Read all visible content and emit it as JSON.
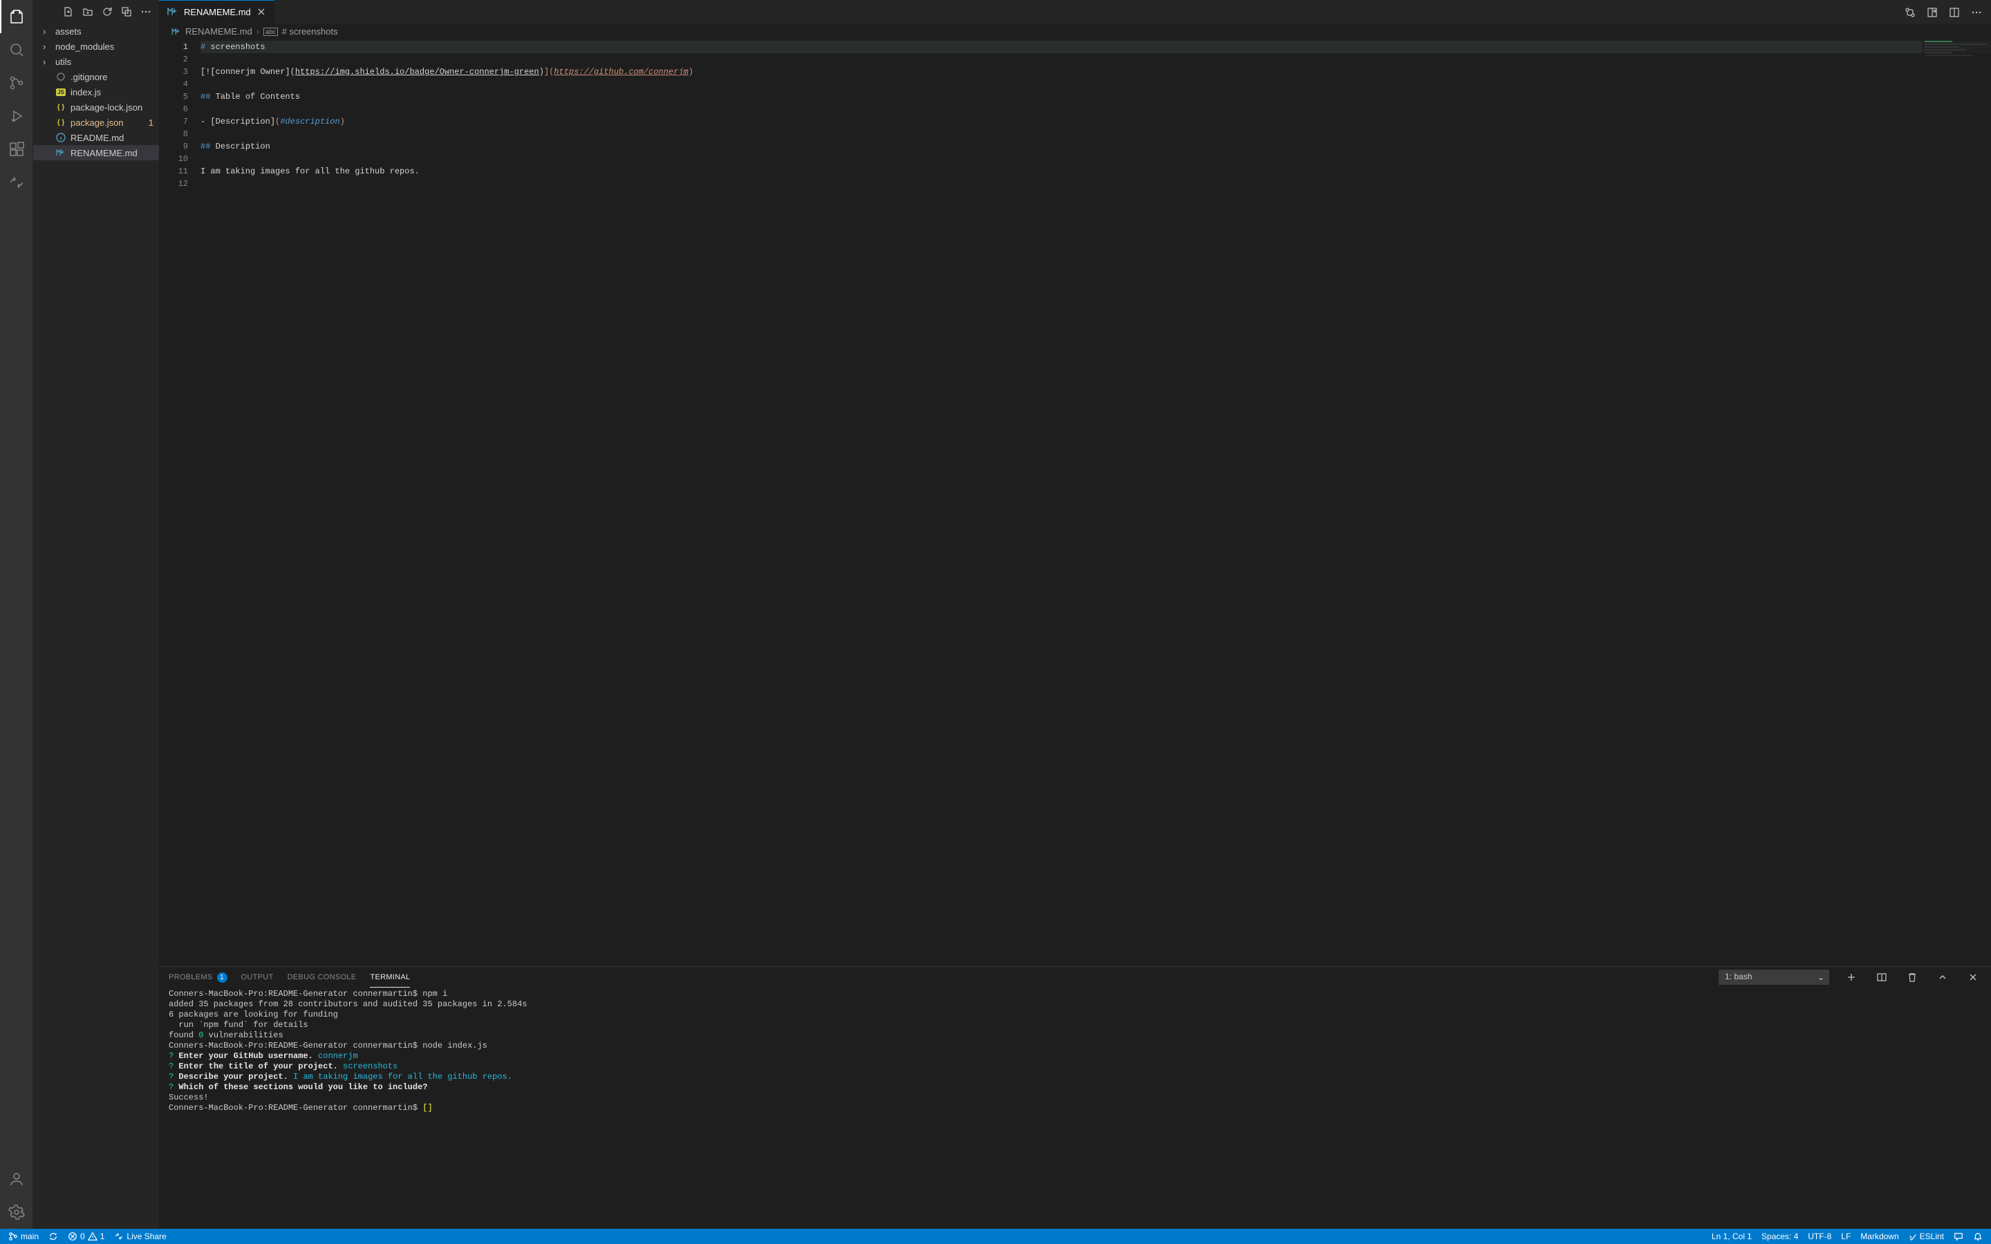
{
  "activity": {
    "items": [
      "explorer",
      "search",
      "scm",
      "debug",
      "extensions",
      "liveshare"
    ],
    "bottom": [
      "account",
      "settings"
    ]
  },
  "sidebar_actions": [
    "new-file",
    "new-folder",
    "refresh",
    "collapse",
    "more"
  ],
  "explorer": {
    "files": [
      {
        "name": "assets",
        "type": "folder"
      },
      {
        "name": "node_modules",
        "type": "folder"
      },
      {
        "name": "utils",
        "type": "folder"
      },
      {
        "name": ".gitignore",
        "type": "file",
        "icon": "git"
      },
      {
        "name": "index.js",
        "type": "file",
        "icon": "js"
      },
      {
        "name": "package-lock.json",
        "type": "file",
        "icon": "json"
      },
      {
        "name": "package.json",
        "type": "file",
        "icon": "json",
        "modified": true,
        "badge": "1"
      },
      {
        "name": "README.md",
        "type": "file",
        "icon": "info"
      },
      {
        "name": "RENAMEME.md",
        "type": "file",
        "icon": "md",
        "selected": true
      }
    ]
  },
  "tab": {
    "name": "RENAMEME.md",
    "icon": "md"
  },
  "breadcrumb": {
    "file": "RENAMEME.md",
    "heading": "# screenshots"
  },
  "editor": {
    "lines": [
      {
        "n": 1,
        "segs": [
          {
            "t": "# ",
            "c": "tok-head"
          },
          {
            "t": "screenshots",
            "c": "tok-plain"
          }
        ],
        "hl": true,
        "active": true
      },
      {
        "n": 2,
        "segs": []
      },
      {
        "n": 3,
        "segs": [
          {
            "t": "[",
            "c": "tok-plain"
          },
          {
            "t": "![connerjm Owner](",
            "c": "tok-plain"
          },
          {
            "t": "https://img.shields.io/badge/Owner-connerjm-green",
            "c": "tok-link"
          },
          {
            "t": ")",
            "c": "tok-plain"
          },
          {
            "t": "]",
            "c": "tok-linkpar"
          },
          {
            "t": "(",
            "c": "tok-linkpar"
          },
          {
            "t": "https://github.com/connerjm",
            "c": "tok-url"
          },
          {
            "t": ")",
            "c": "tok-linkpar"
          }
        ]
      },
      {
        "n": 4,
        "segs": []
      },
      {
        "n": 5,
        "segs": [
          {
            "t": "## ",
            "c": "tok-head"
          },
          {
            "t": "Table of Contents",
            "c": "tok-plain"
          }
        ]
      },
      {
        "n": 6,
        "segs": []
      },
      {
        "n": 7,
        "segs": [
          {
            "t": "- [Description]",
            "c": "tok-plain"
          },
          {
            "t": "(",
            "c": "tok-linkpar"
          },
          {
            "t": "#description",
            "c": "tok-hash"
          },
          {
            "t": ")",
            "c": "tok-linkpar"
          }
        ]
      },
      {
        "n": 8,
        "segs": []
      },
      {
        "n": 9,
        "segs": [
          {
            "t": "## ",
            "c": "tok-head"
          },
          {
            "t": "Description",
            "c": "tok-plain"
          }
        ]
      },
      {
        "n": 10,
        "segs": []
      },
      {
        "n": 11,
        "segs": [
          {
            "t": "I am taking images for all the github repos.",
            "c": "tok-plain"
          }
        ]
      },
      {
        "n": 12,
        "segs": []
      }
    ]
  },
  "panel": {
    "tabs": {
      "problems": "PROBLEMS",
      "problems_count": "1",
      "output": "OUTPUT",
      "debug": "DEBUG CONSOLE",
      "terminal": "TERMINAL"
    },
    "active": "terminal",
    "term_select": "1: bash"
  },
  "terminal": {
    "lines": [
      [
        {
          "t": "Conners-MacBook-Pro:README-Generator connermartin$ npm i"
        }
      ],
      [
        {
          "t": "added 35 packages from 28 contributors and audited 35 packages in 2.584s"
        }
      ],
      [
        {
          "t": ""
        }
      ],
      [
        {
          "t": "6 packages are looking for funding"
        }
      ],
      [
        {
          "t": "  run `npm fund` for details"
        }
      ],
      [
        {
          "t": ""
        }
      ],
      [
        {
          "t": "found "
        },
        {
          "t": "0",
          "c": "t-green"
        },
        {
          "t": " vulnerabilities"
        }
      ],
      [
        {
          "t": ""
        }
      ],
      [
        {
          "t": "Conners-MacBook-Pro:README-Generator connermartin$ node index.js"
        }
      ],
      [
        {
          "t": "? ",
          "c": "t-green"
        },
        {
          "t": "Enter your GitHub username.",
          "c": "t-white-b"
        },
        {
          "t": " connerjm",
          "c": "t-cyan"
        }
      ],
      [
        {
          "t": "? ",
          "c": "t-green"
        },
        {
          "t": "Enter the title of your project.",
          "c": "t-white-b"
        },
        {
          "t": " screenshots",
          "c": "t-cyan"
        }
      ],
      [
        {
          "t": "? ",
          "c": "t-green"
        },
        {
          "t": "Describe your project.",
          "c": "t-white-b"
        },
        {
          "t": " I am taking images for all the github repos.",
          "c": "t-cyan"
        }
      ],
      [
        {
          "t": "? ",
          "c": "t-green"
        },
        {
          "t": "Which of these sections would you like to include?",
          "c": "t-white-b"
        }
      ],
      [
        {
          "t": "Success!"
        }
      ],
      [
        {
          "t": "Conners-MacBook-Pro:README-Generator connermartin$ "
        },
        {
          "t": "[]",
          "c": "t-cursor"
        }
      ]
    ]
  },
  "status": {
    "branch": "main",
    "errors": "0",
    "warnings": "1",
    "liveshare": "Live Share",
    "cursor": "Ln 1, Col 1",
    "indent": "Spaces: 4",
    "encoding": "UTF-8",
    "eol": "LF",
    "language": "Markdown",
    "eslint": "ESLint"
  }
}
